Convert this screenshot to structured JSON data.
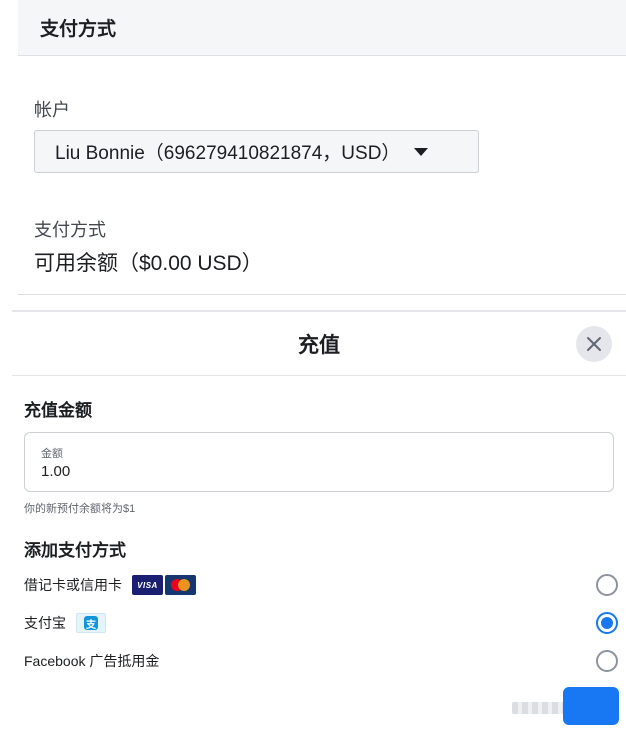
{
  "top_card": {
    "header_title": "支付方式",
    "account_label": "帐户",
    "account_value": "Liu Bonnie（696279410821874，USD）",
    "payment_method_label": "支付方式",
    "balance_text": "可用余额（$0.00 USD）"
  },
  "dialog": {
    "title": "充值",
    "amount_section_title": "充值金额",
    "amount_field_label": "金额",
    "amount_value": "1.00",
    "hint_text": "你的新预付余额将为$1",
    "add_payment_title": "添加支付方式",
    "payment_options": [
      {
        "label": "借记卡或信用卡",
        "selected": false
      },
      {
        "label": "支付宝",
        "selected": true
      },
      {
        "label": "Facebook 广告抵用金",
        "selected": false
      }
    ],
    "card_brand_visa": "VISA",
    "alipay_glyph": "支"
  },
  "icons": {
    "account_dropdown": "caret-down-icon",
    "close": "close-icon",
    "visa": "visa-icon",
    "mastercard": "mastercard-icon",
    "alipay": "alipay-icon"
  },
  "colors": {
    "accent": "#1877f2",
    "header_bg": "#f5f6f7",
    "border": "#dddfe2",
    "text": "#1c1e21"
  }
}
